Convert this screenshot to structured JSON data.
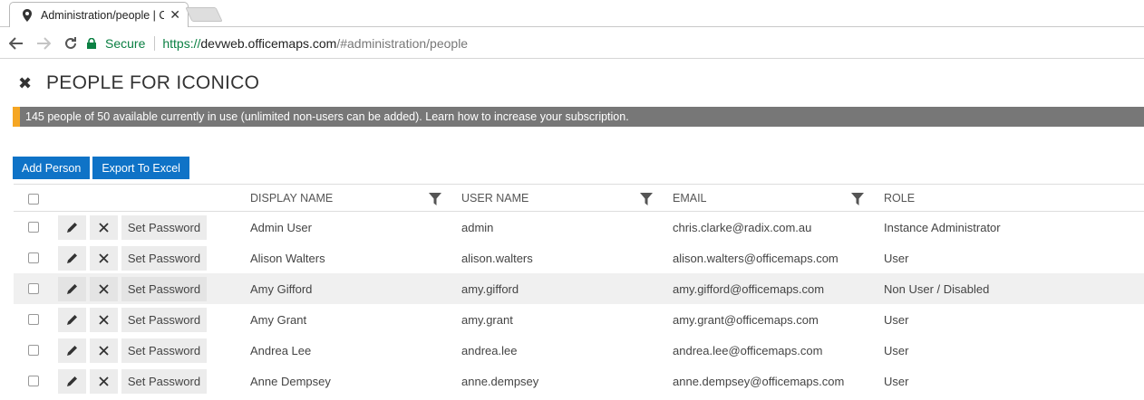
{
  "browser": {
    "tab_title": "Administration/people | C",
    "secure_label": "Secure",
    "url_scheme": "https://",
    "url_host": "devweb.officemaps.com",
    "url_path": "/#administration/people"
  },
  "page": {
    "title": "PEOPLE FOR ICONICO",
    "banner": "145 people of 50 available currently in use (unlimited non-users can be added). Learn how to increase your subscription."
  },
  "actions": {
    "add_person": "Add Person",
    "export_excel": "Export To Excel"
  },
  "table": {
    "columns": [
      "DISPLAY NAME",
      "USER NAME",
      "EMAIL",
      "ROLE"
    ],
    "set_password_label": "Set Password",
    "rows": [
      {
        "display": "Admin User",
        "user": "admin",
        "email": "chris.clarke@radix.com.au",
        "role": "Instance Administrator"
      },
      {
        "display": "Alison Walters",
        "user": "alison.walters",
        "email": "alison.walters@officemaps.com",
        "role": "User"
      },
      {
        "display": "Amy Gifford",
        "user": "amy.gifford",
        "email": "amy.gifford@officemaps.com",
        "role": "Non User / Disabled"
      },
      {
        "display": "Amy Grant",
        "user": "amy.grant",
        "email": "amy.grant@officemaps.com",
        "role": "User"
      },
      {
        "display": "Andrea Lee",
        "user": "andrea.lee",
        "email": "andrea.lee@officemaps.com",
        "role": "User"
      },
      {
        "display": "Anne Dempsey",
        "user": "anne.dempsey",
        "email": "anne.dempsey@officemaps.com",
        "role": "User"
      }
    ]
  }
}
